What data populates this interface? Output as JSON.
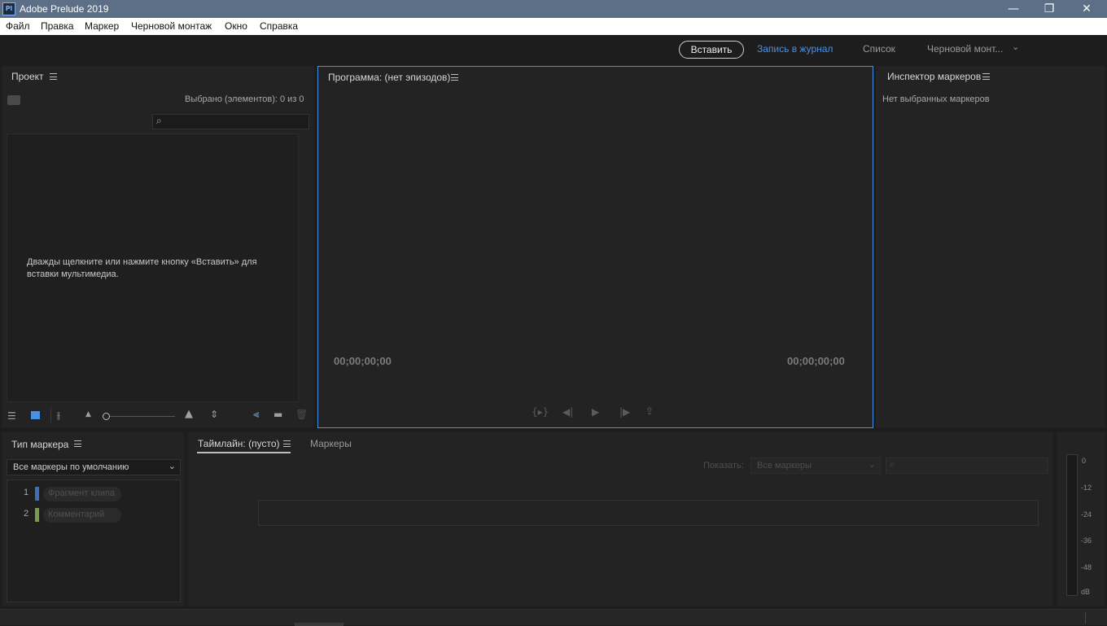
{
  "window": {
    "title": "Adobe Prelude 2019",
    "app_icon_text": "Pl"
  },
  "menu": [
    "Файл",
    "Правка",
    "Маркер",
    "Черновой монтаж",
    "Окно",
    "Справка"
  ],
  "workspace": {
    "insert": "Вставить",
    "tabs": [
      "Запись в журнал",
      "Список",
      "Черновой монт..."
    ]
  },
  "project": {
    "title": "Проект",
    "selected": "Выбрано (элементов): 0 из 0",
    "search_placeholder": "",
    "hint": "Дважды щелкните или нажмите кнопку «Вставить» для вставки мультимедиа."
  },
  "program": {
    "title": "Программа: (нет эпизодов)",
    "tc_left": "00;00;00;00",
    "tc_right": "00;00;00;00"
  },
  "inspector": {
    "title": "Инспектор маркеров",
    "empty": "Нет выбранных маркеров"
  },
  "marker_type": {
    "title": "Тип маркера",
    "dropdown": "Все маркеры по умолчанию",
    "items": [
      {
        "num": "1",
        "label": "Фрагмент клипа",
        "color": "#3e6fb4"
      },
      {
        "num": "2",
        "label": "Комментарий",
        "color": "#7b9a4a"
      }
    ]
  },
  "timeline": {
    "tab_active": "Таймлайн: (пусто)",
    "tab_markers": "Маркеры",
    "show_label": "Показать:",
    "show_value": "Все маркеры",
    "search_placeholder": ""
  },
  "meter": {
    "labels": [
      "0",
      "-12",
      "-24",
      "-36",
      "-48",
      "dB"
    ]
  },
  "colors": {
    "accent_blue": "#4a90e2",
    "panel_bg": "#232323",
    "app_bg": "#1d1d1d"
  }
}
